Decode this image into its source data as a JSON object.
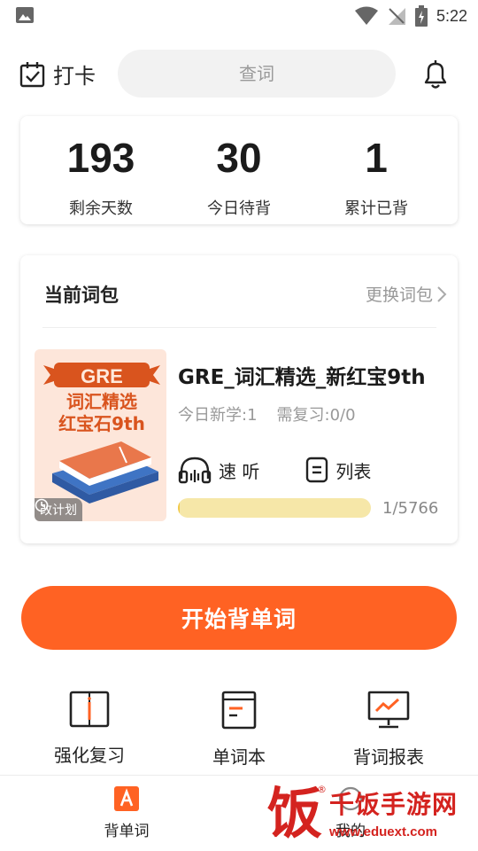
{
  "status_bar": {
    "time": "5:22",
    "icons": [
      "image-icon",
      "wifi-icon",
      "no-signal-icon",
      "battery-charging-icon"
    ]
  },
  "header": {
    "checkin_label": "打卡",
    "search_placeholder": "查词",
    "icons": [
      "calendar-check-icon",
      "bell-icon"
    ]
  },
  "stats": [
    {
      "value": "193",
      "label": "剩余天数"
    },
    {
      "value": "30",
      "label": "今日待背"
    },
    {
      "value": "1",
      "label": "累计已背"
    }
  ],
  "current_book": {
    "section_title": "当前词包",
    "change_label": "更换词包",
    "cover": {
      "badge": "GRE",
      "line1": "词汇精选",
      "line2": "红宝石9th",
      "plan_label": "改计划"
    },
    "title": "GRE_词汇精选_新红宝9th",
    "new_today": "今日新学:1",
    "review": "需复习:0/0",
    "actions": {
      "listen": "速 听",
      "list": "列表"
    },
    "progress_text": "1/5766",
    "progress_fraction": 0.00017
  },
  "start_button_label": "开始背单词",
  "tools": [
    {
      "label": "强化复习",
      "icon": "review-book-icon"
    },
    {
      "label": "单词本",
      "icon": "wordbook-icon"
    },
    {
      "label": "背词报表",
      "icon": "report-chart-icon"
    }
  ],
  "bottom_nav": [
    {
      "label": "背单词",
      "icon": "letter-a-icon",
      "active": true
    },
    {
      "label": "我的",
      "icon": "profile-icon",
      "active": false
    }
  ],
  "watermark": {
    "char": "饭",
    "title": "千饭手游网",
    "url": "www.eduext.com",
    "reg": "®"
  },
  "colors": {
    "accent": "#ff6223",
    "progress_track": "#f6e7a8",
    "cover_bg": "#fde6da",
    "watermark": "#d4231f"
  }
}
